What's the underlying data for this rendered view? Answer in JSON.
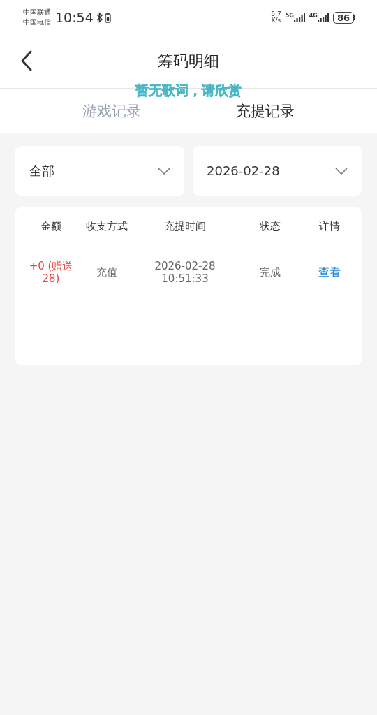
{
  "status_bar": {
    "carriers": [
      "中国联通",
      "中国电信"
    ],
    "time": "10:54",
    "network_speed": "6.7",
    "speed_unit": "K/s",
    "signals": [
      "5G",
      "4G"
    ],
    "battery": "86"
  },
  "header": {
    "title": "筹码明细"
  },
  "lyrics_overlay": "暂无歌词，请欣赏",
  "tabs": [
    {
      "label": "游戏记录",
      "selected": false
    },
    {
      "label": "充提记录",
      "selected": true
    }
  ],
  "filters": [
    {
      "value": "全部"
    },
    {
      "value": "2026-02-28"
    }
  ],
  "table": {
    "columns": [
      "金额",
      "收支方式",
      "充提时间",
      "状态",
      "详情"
    ],
    "rows": [
      {
        "amount": "+0 (赠送28)",
        "method": "充值",
        "time": "2026-02-28 10:51:33",
        "status": "完成",
        "detail": "查看"
      }
    ]
  }
}
